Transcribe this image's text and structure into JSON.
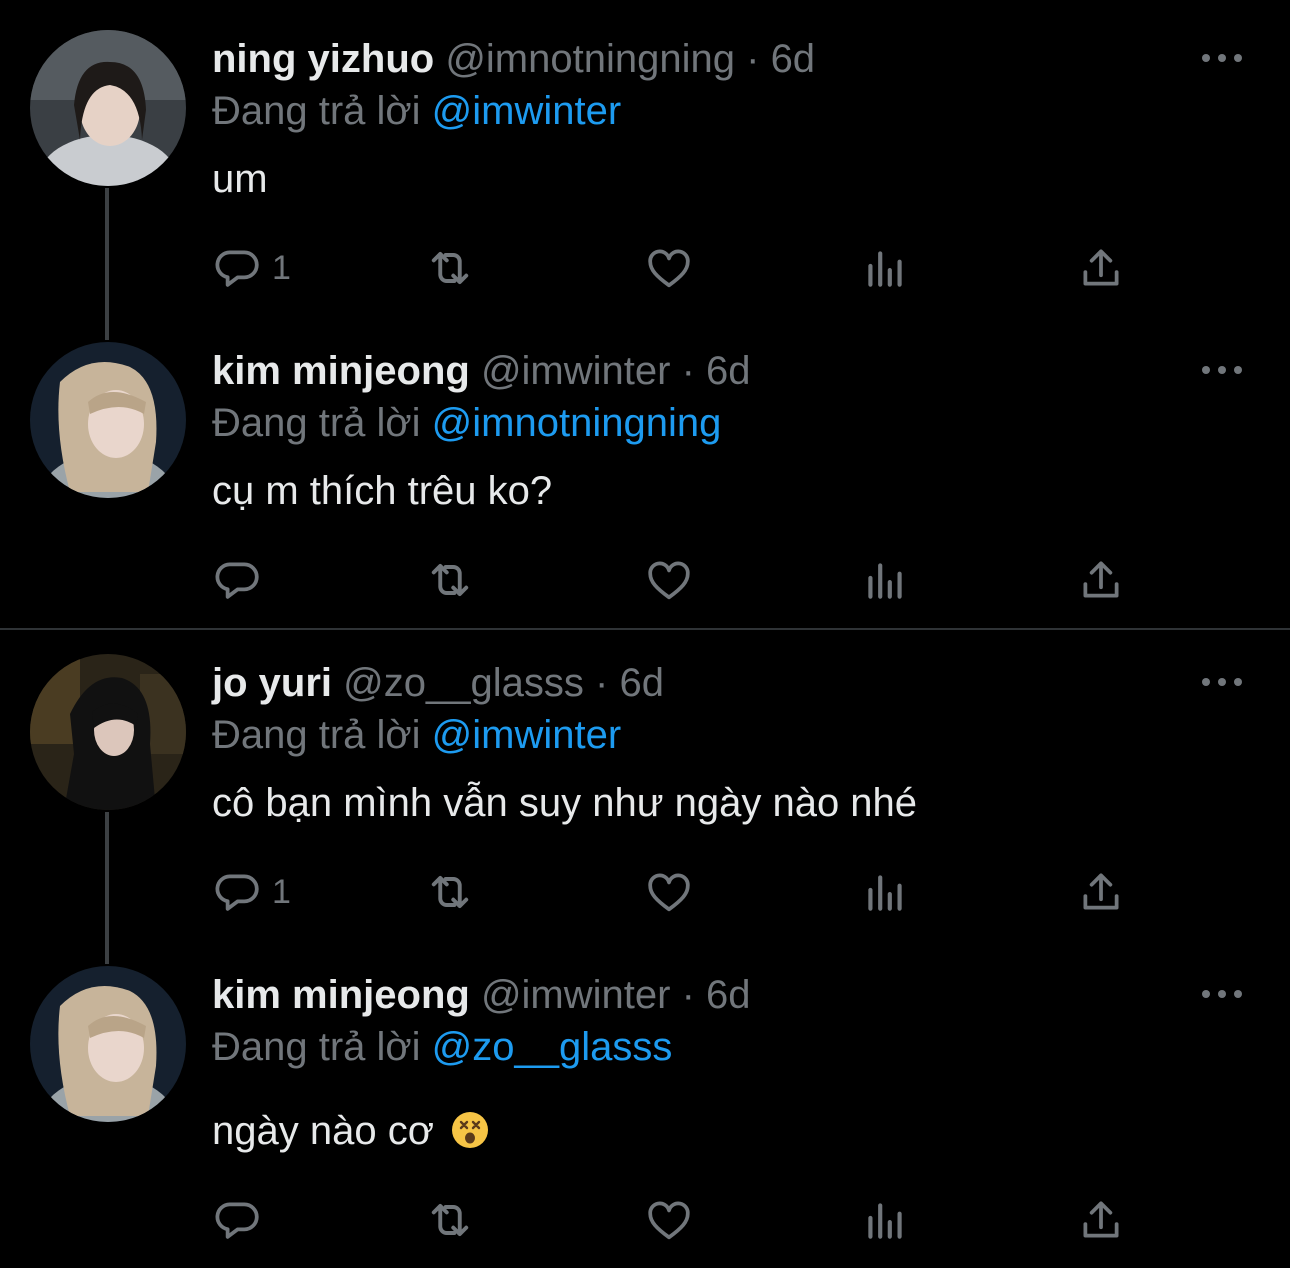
{
  "theme": {
    "background": "#000000",
    "text_primary": "#e7e9ea",
    "text_secondary": "#71767b",
    "accent": "#1d9bf0"
  },
  "reply_prefix": "Đang trả lời",
  "tweets": [
    {
      "name": "ning yizhuo",
      "handle": "@imnotningning",
      "separator": "·",
      "time": "6d",
      "reply_to": "@imwinter",
      "text": "um",
      "reply_count": "1",
      "avatar_icon": "avatar-photo"
    },
    {
      "name": "kim minjeong",
      "handle": "@imwinter",
      "separator": "·",
      "time": "6d",
      "reply_to": "@imnotningning",
      "text": "cụ m thích trêu ko?",
      "reply_count": "",
      "avatar_icon": "avatar-photo"
    },
    {
      "name": "jo yuri",
      "handle": "@zo__glasss",
      "separator": "·",
      "time": "6d",
      "reply_to": "@imwinter",
      "text": "cô bạn mình vẫn suy như ngày nào nhé",
      "reply_count": "1",
      "avatar_icon": "avatar-photo"
    },
    {
      "name": "kim minjeong",
      "handle": "@imwinter",
      "separator": "·",
      "time": "6d",
      "reply_to": "@zo__glasss",
      "text": "ngày nào cơ",
      "reply_count": "",
      "avatar_icon": "avatar-photo",
      "emoji": "dizzy-face-emoji"
    }
  ]
}
